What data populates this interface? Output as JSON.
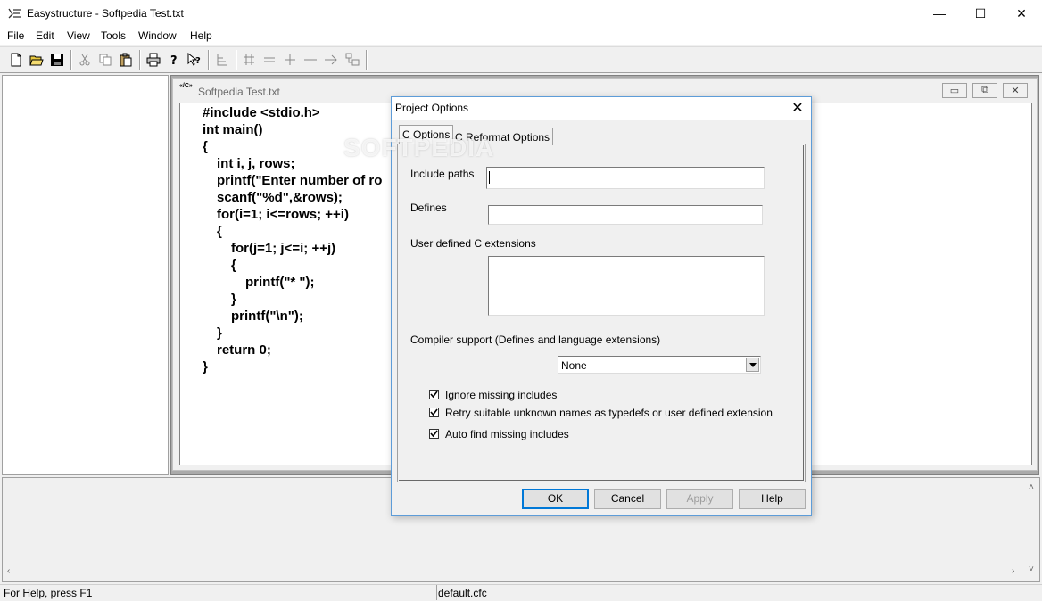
{
  "window": {
    "title": "Easystructure - Softpedia Test.txt",
    "minimize": "—",
    "maximize": "☐",
    "close": "✕"
  },
  "menu": [
    "File",
    "Edit",
    "View",
    "Tools",
    "Window",
    "Help"
  ],
  "toolbar_icons": [
    "new-file-icon",
    "open-folder-icon",
    "save-icon",
    "cut-icon",
    "copy-icon",
    "paste-icon",
    "print-icon",
    "help-icon",
    "context-help-icon",
    "tree-structure-icon",
    "grid-icon",
    "minus-icon",
    "plus-icon",
    "dash-icon",
    "arrow-right-icon",
    "structure-icon"
  ],
  "child_window": {
    "title": "Softpedia Test.txt",
    "icon_text": "«/C»",
    "minimize": "▭",
    "restore": "⧉",
    "close": "✕"
  },
  "code_lines": [
    {
      "indent": 0,
      "text": "#include <stdio.h>"
    },
    {
      "indent": 0,
      "text": "int main()"
    },
    {
      "indent": 0,
      "text": "{"
    },
    {
      "indent": 1,
      "text": "int i, j, rows;"
    },
    {
      "indent": 1,
      "text": "printf(\"Enter number of ro"
    },
    {
      "indent": 1,
      "text": "scanf(\"%d\",&rows);"
    },
    {
      "indent": 1,
      "text": "for(i=1; i<=rows; ++i)"
    },
    {
      "indent": 1,
      "text": "{"
    },
    {
      "indent": 2,
      "text": "for(j=1; j<=i; ++j)"
    },
    {
      "indent": 2,
      "text": "{"
    },
    {
      "indent": 3,
      "text": "printf(\"* \");"
    },
    {
      "indent": 2,
      "text": "}"
    },
    {
      "indent": 2,
      "text": "printf(\"\\n\");"
    },
    {
      "indent": 1,
      "text": "}"
    },
    {
      "indent": 1,
      "text": "return 0;"
    },
    {
      "indent": 0,
      "text": "}"
    }
  ],
  "status": {
    "left": "For Help, press F1",
    "right": "default.cfc"
  },
  "scroll": {
    "left": "‹",
    "right": "›",
    "up": "˄",
    "down": "˅"
  },
  "watermark": "SOFTPEDIA",
  "dialog": {
    "title": "Project Options",
    "close": "✕",
    "tabs": [
      "C Options",
      "C Reformat Options"
    ],
    "include_paths_label": "Include paths",
    "include_paths_value": "",
    "defines_label": "Defines",
    "defines_value": "",
    "extensions_label": "User defined C extensions",
    "extensions_value": "",
    "compiler_label": "Compiler support (Defines and language extensions)",
    "compiler_value": "None",
    "checkboxes": [
      {
        "label": "Ignore missing includes",
        "checked": true
      },
      {
        "label": "Retry suitable unknown names as typedefs or user defined extension",
        "checked": true
      },
      {
        "label": "Auto find missing includes",
        "checked": true
      }
    ],
    "buttons": {
      "ok": "OK",
      "cancel": "Cancel",
      "apply": "Apply",
      "help": "Help"
    }
  }
}
